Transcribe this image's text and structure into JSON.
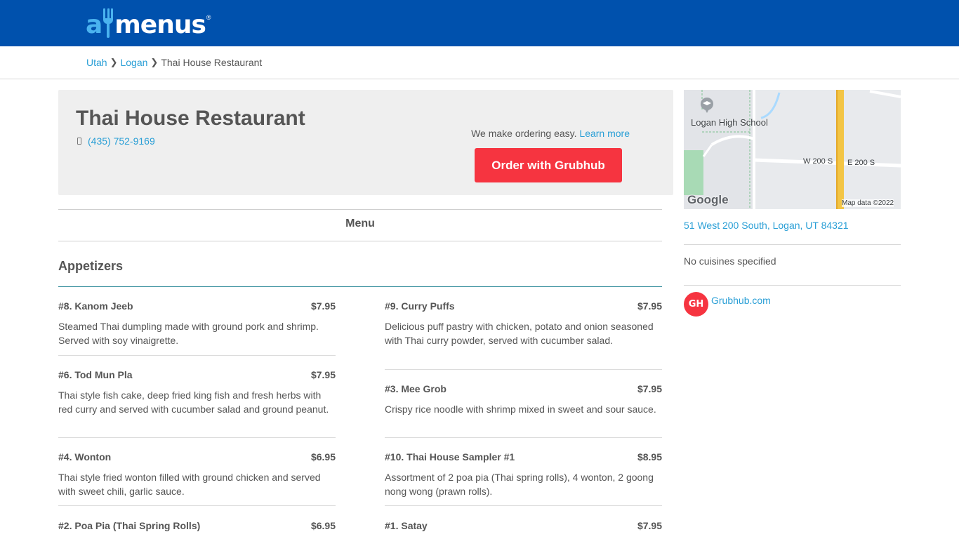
{
  "header": {
    "logo_prefix": "a",
    "logo_brand": "menus",
    "logo_reg": "®",
    "colors": {
      "bar": "#0051ad",
      "accent": "#4ab3ef"
    }
  },
  "breadcrumb": {
    "items": [
      "Utah",
      "Logan"
    ],
    "current": "Thai House Restaurant"
  },
  "restaurant": {
    "name": "Thai House Restaurant",
    "phone": "(435) 752-9169",
    "order_text": "We make ordering easy.",
    "learn_more": "Learn more",
    "order_button": "Order with Grubhub"
  },
  "menu_tab": "Menu",
  "section": "Appetizers",
  "menu_items": [
    {
      "name": "#8. Kanom Jeeb",
      "price": "$7.95",
      "desc": "Steamed Thai dumpling made with ground pork and shrimp. Served with soy vinaigrette."
    },
    {
      "name": "#9. Curry Puffs",
      "price": "$7.95",
      "desc": "Delicious puff pastry with chicken, potato and onion seasoned with Thai curry powder, served with cucumber salad."
    },
    {
      "name": "#6. Tod Mun Pla",
      "price": "$7.95",
      "desc": "Thai style fish cake, deep fried king fish and fresh herbs with red curry and served with cucumber salad and ground peanut."
    },
    {
      "name": "#3. Mee Grob",
      "price": "$7.95",
      "desc": "Crispy rice noodle with shrimp mixed in sweet and sour sauce."
    },
    {
      "name": "#4. Wonton",
      "price": "$6.95",
      "desc": "Thai style fried wonton filled with ground chicken and served with sweet chili, garlic sauce."
    },
    {
      "name": "#10. Thai House Sampler #1",
      "price": "$8.95",
      "desc": "Assortment of 2 poa pia (Thai spring rolls), 4 wonton, 2 goong nong wong (prawn rolls)."
    },
    {
      "name": "#2. Poa Pia (Thai Spring Rolls)",
      "price": "$6.95",
      "desc": ""
    },
    {
      "name": "#1. Satay",
      "price": "$7.95",
      "desc": ""
    }
  ],
  "map": {
    "school_label": "Logan High School",
    "street_w": "W 200 S",
    "street_e": "E 200 S",
    "google": "Google",
    "attribution": "Map data ©2022"
  },
  "sidebar": {
    "address": "51 West 200 South, Logan, UT 84321",
    "cuisines": "No cuisines specified",
    "gh_badge": "GH",
    "gh_link": "Grubhub.com"
  }
}
